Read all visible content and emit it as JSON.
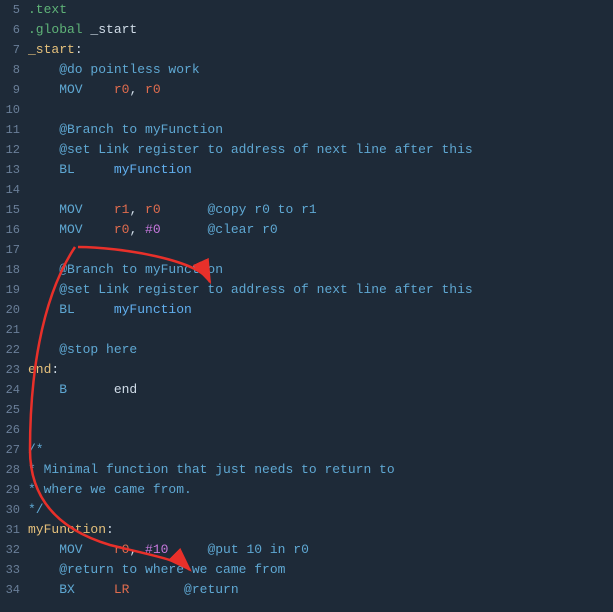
{
  "lines": [
    {
      "num": "5",
      "tokens": [
        {
          "text": ".text",
          "cls": "kw-directive"
        }
      ]
    },
    {
      "num": "6",
      "tokens": [
        {
          "text": ".global",
          "cls": "kw-directive"
        },
        {
          "text": " _start",
          "cls": "kw-white"
        }
      ]
    },
    {
      "num": "7",
      "tokens": [
        {
          "text": "_start",
          "cls": "kw-label"
        },
        {
          "text": ":",
          "cls": "kw-white"
        }
      ]
    },
    {
      "num": "8",
      "tokens": [
        {
          "text": "    @do pointless work",
          "cls": "kw-comment"
        }
      ]
    },
    {
      "num": "9",
      "tokens": [
        {
          "text": "    MOV",
          "cls": "kw-blue"
        },
        {
          "text": "    ",
          "cls": "kw-white"
        },
        {
          "text": "r0",
          "cls": "kw-reg"
        },
        {
          "text": ", ",
          "cls": "kw-white"
        },
        {
          "text": "r0",
          "cls": "kw-reg"
        }
      ]
    },
    {
      "num": "10",
      "tokens": []
    },
    {
      "num": "11",
      "tokens": [
        {
          "text": "    @Branch to myFunction",
          "cls": "kw-comment"
        }
      ]
    },
    {
      "num": "12",
      "tokens": [
        {
          "text": "    @set Link register to address of next line after this",
          "cls": "kw-comment"
        }
      ]
    },
    {
      "num": "13",
      "tokens": [
        {
          "text": "    BL",
          "cls": "kw-blue"
        },
        {
          "text": "     ",
          "cls": "kw-white"
        },
        {
          "text": "myFunction",
          "cls": "kw-myFunc"
        }
      ]
    },
    {
      "num": "14",
      "tokens": []
    },
    {
      "num": "15",
      "tokens": [
        {
          "text": "    MOV",
          "cls": "kw-blue"
        },
        {
          "text": "    ",
          "cls": "kw-white"
        },
        {
          "text": "r1",
          "cls": "kw-reg"
        },
        {
          "text": ", ",
          "cls": "kw-white"
        },
        {
          "text": "r0",
          "cls": "kw-reg"
        },
        {
          "text": "      @copy r0 to r1",
          "cls": "kw-comment"
        }
      ]
    },
    {
      "num": "16",
      "tokens": [
        {
          "text": "    MOV",
          "cls": "kw-blue"
        },
        {
          "text": "    ",
          "cls": "kw-white"
        },
        {
          "text": "r0",
          "cls": "kw-reg"
        },
        {
          "text": ", ",
          "cls": "kw-white"
        },
        {
          "text": "#0",
          "cls": "kw-num"
        },
        {
          "text": "      @clear r0",
          "cls": "kw-comment"
        }
      ]
    },
    {
      "num": "17",
      "tokens": []
    },
    {
      "num": "18",
      "tokens": [
        {
          "text": "    @Branch to myFunction",
          "cls": "kw-comment"
        }
      ]
    },
    {
      "num": "19",
      "tokens": [
        {
          "text": "    @set Link register to address of next line after this",
          "cls": "kw-comment"
        }
      ]
    },
    {
      "num": "20",
      "tokens": [
        {
          "text": "    BL",
          "cls": "kw-blue"
        },
        {
          "text": "     ",
          "cls": "kw-white"
        },
        {
          "text": "myFunction",
          "cls": "kw-myFunc"
        }
      ]
    },
    {
      "num": "21",
      "tokens": []
    },
    {
      "num": "22",
      "tokens": [
        {
          "text": "    @stop here",
          "cls": "kw-comment"
        }
      ]
    },
    {
      "num": "23",
      "tokens": [
        {
          "text": "end",
          "cls": "kw-label"
        },
        {
          "text": ":",
          "cls": "kw-white"
        }
      ]
    },
    {
      "num": "24",
      "tokens": [
        {
          "text": "    B",
          "cls": "kw-blue"
        },
        {
          "text": "      end",
          "cls": "kw-white"
        }
      ]
    },
    {
      "num": "25",
      "tokens": []
    },
    {
      "num": "26",
      "tokens": []
    },
    {
      "num": "27",
      "tokens": [
        {
          "text": "/*",
          "cls": "kw-comment"
        }
      ]
    },
    {
      "num": "28",
      "tokens": [
        {
          "text": "* Minimal function that just needs to return to",
          "cls": "kw-comment"
        }
      ]
    },
    {
      "num": "29",
      "tokens": [
        {
          "text": "* where we came ",
          "cls": "kw-comment"
        },
        {
          "text": "from",
          "cls": "kw-comment"
        },
        {
          "text": ".",
          "cls": "kw-comment"
        }
      ]
    },
    {
      "num": "30",
      "tokens": [
        {
          "text": "*/",
          "cls": "kw-comment"
        }
      ]
    },
    {
      "num": "31",
      "tokens": [
        {
          "text": "myFunction",
          "cls": "kw-label"
        },
        {
          "text": ":",
          "cls": "kw-white"
        }
      ]
    },
    {
      "num": "32",
      "tokens": [
        {
          "text": "    MOV",
          "cls": "kw-blue"
        },
        {
          "text": "    ",
          "cls": "kw-white"
        },
        {
          "text": "r0",
          "cls": "kw-reg"
        },
        {
          "text": ", ",
          "cls": "kw-white"
        },
        {
          "text": "#10",
          "cls": "kw-num"
        },
        {
          "text": "     @put 10 in r0",
          "cls": "kw-comment"
        }
      ]
    },
    {
      "num": "33",
      "tokens": [
        {
          "text": "    @return to where we came from",
          "cls": "kw-comment"
        }
      ]
    },
    {
      "num": "34",
      "tokens": [
        {
          "text": "    BX",
          "cls": "kw-blue"
        },
        {
          "text": "     ",
          "cls": "kw-white"
        },
        {
          "text": "LR",
          "cls": "kw-reg"
        },
        {
          "text": "       @return",
          "cls": "kw-comment"
        }
      ]
    }
  ]
}
